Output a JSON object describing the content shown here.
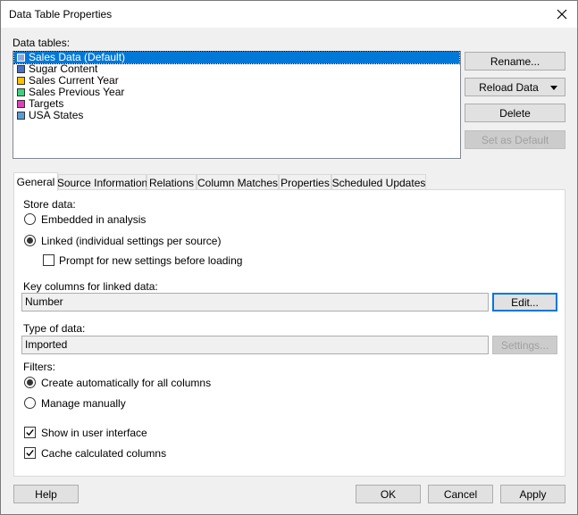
{
  "window": {
    "title": "Data Table Properties"
  },
  "data_tables": {
    "label": "Data tables:",
    "items": [
      {
        "label": "Sales Data (Default)",
        "color": "#8ea9db",
        "selected": true
      },
      {
        "label": "Sugar Content",
        "color": "#4472c4",
        "selected": false
      },
      {
        "label": "Sales Current Year",
        "color": "#ffc000",
        "selected": false
      },
      {
        "label": "Sales Previous Year",
        "color": "#40d080",
        "selected": false
      },
      {
        "label": "Targets",
        "color": "#e040c0",
        "selected": false
      },
      {
        "label": "USA States",
        "color": "#5b9bd5",
        "selected": false
      }
    ]
  },
  "side_buttons": {
    "rename": "Rename...",
    "reload": "Reload Data",
    "delete": "Delete",
    "set_default": "Set as Default"
  },
  "tabs": [
    {
      "label": "General",
      "active": true
    },
    {
      "label": "Source Information",
      "active": false
    },
    {
      "label": "Relations",
      "active": false
    },
    {
      "label": "Column Matches",
      "active": false
    },
    {
      "label": "Properties",
      "active": false
    },
    {
      "label": "Scheduled Updates",
      "active": false
    }
  ],
  "general": {
    "store_data_label": "Store data:",
    "embedded_label": "Embedded in analysis",
    "embedded_selected": false,
    "linked_label": "Linked (individual settings per source)",
    "linked_selected": true,
    "prompt_label": "Prompt for new settings before loading",
    "prompt_checked": false,
    "key_columns_label": "Key columns for linked data:",
    "key_columns_value": "Number",
    "edit_button": "Edit...",
    "type_label": "Type of data:",
    "type_value": "Imported",
    "settings_button": "Settings...",
    "filters_label": "Filters:",
    "create_auto_label": "Create automatically for all columns",
    "create_auto_selected": true,
    "manage_label": "Manage manually",
    "manage_selected": false,
    "show_ui_label": "Show in user interface",
    "show_ui_checked": true,
    "cache_label": "Cache calculated columns",
    "cache_checked": true
  },
  "footer": {
    "help": "Help",
    "ok": "OK",
    "cancel": "Cancel",
    "apply": "Apply"
  },
  "colors": {
    "accent": "#0078d7"
  }
}
